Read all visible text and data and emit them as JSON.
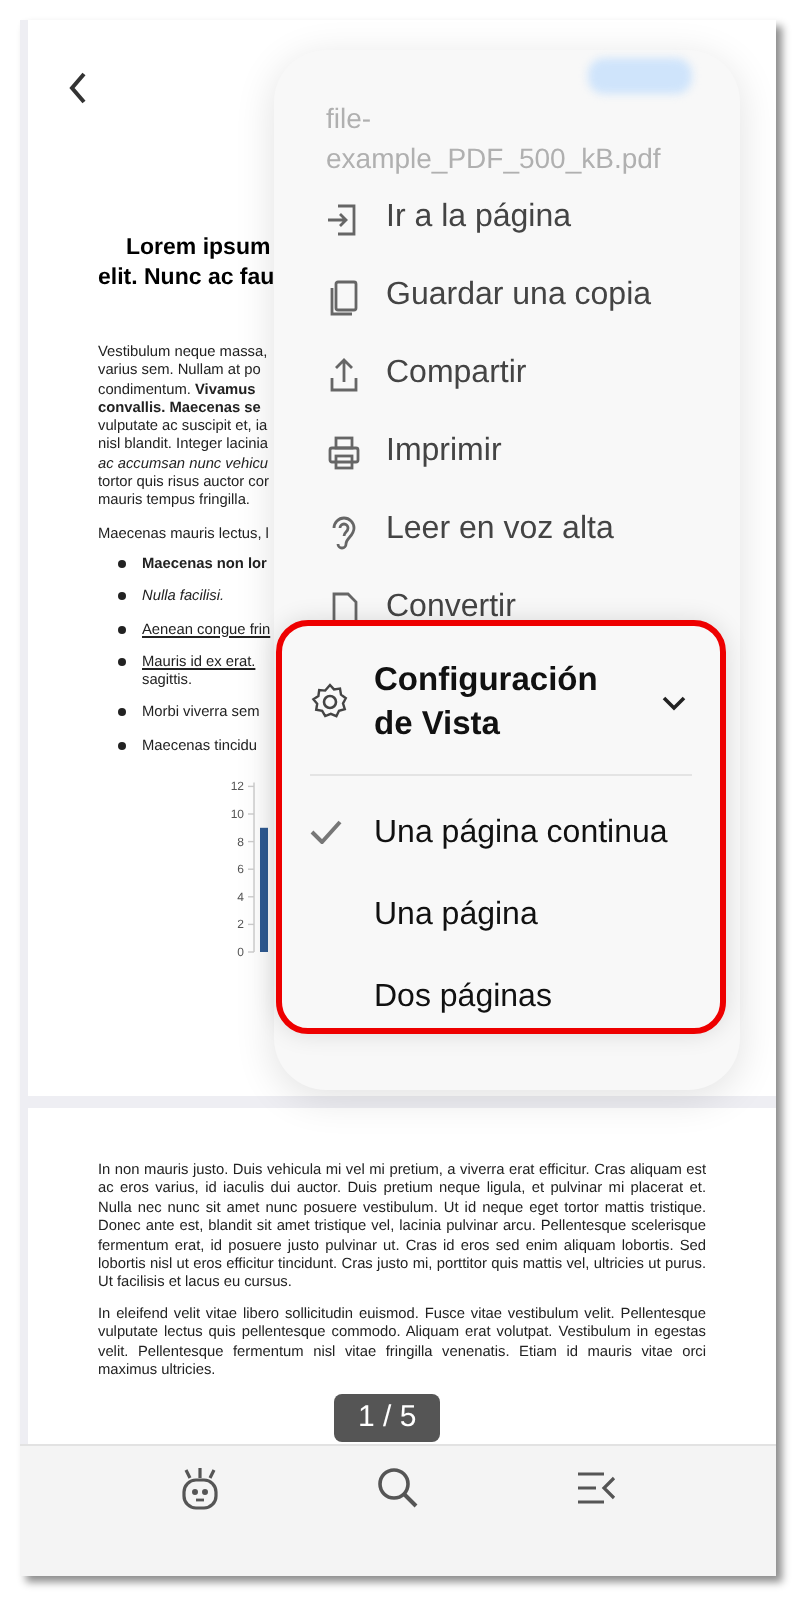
{
  "document": {
    "title_lines": [
      "Lorem ipsum",
      "elit. Nunc ac fau"
    ],
    "paragraph_lines": [
      "Vestibulum neque massa,",
      "varius sem. Nullam at po",
      "condimentum. **Vivamus**",
      "**convallis. Maecenas se**",
      "vulputate ac suscipit et, ia",
      "nisl blandit. Integer lacinia",
      "*ac accumsan nunc vehicu*",
      "tortor quis risus auctor cor",
      "mauris tempus fringilla."
    ],
    "paragraph2": "Maecenas mauris lectus, l",
    "bullets": [
      {
        "text": "Maecenas non lor",
        "kind": "bold"
      },
      {
        "text": "Nulla facilisi.",
        "kind": "italic"
      },
      {
        "text": "Aenean congue frin",
        "kind": "underline"
      },
      {
        "text": "Mauris id ex erat.",
        "kind": "underline",
        "continuation": "sagittis."
      },
      {
        "text": "Morbi viverra sem",
        "kind": "plain"
      },
      {
        "text": "Maecenas tincidu",
        "kind": "plain"
      }
    ],
    "chart_data": {
      "type": "bar",
      "yticks": [
        0,
        2,
        4,
        6,
        8,
        10,
        12
      ],
      "ylim": [
        0,
        12
      ],
      "series": [
        {
          "color": "#2f5b93",
          "values": [
            9
          ]
        }
      ]
    },
    "page2_paragraphs": [
      "In non mauris justo. Duis vehicula mi vel mi pretium, a viverra erat efficitur. Cras aliquam est ac eros varius, id iaculis dui auctor. Duis pretium neque ligula, et pulvinar mi placerat et. Nulla nec nunc sit amet nunc posuere vestibulum. Ut id neque eget tortor mattis tristique. Donec ante est, blandit sit amet tristique vel, lacinia pulvinar arcu. Pellentesque scelerisque fermentum erat, id posuere justo pulvinar ut. Cras id eros sed enim aliquam lobortis. Sed lobortis nisl ut eros efficitur tincidunt. Cras justo mi, porttitor quis mattis vel, ultricies ut purus. Ut facilisis et lacus eu cursus.",
      "In eleifend velit vitae libero sollicitudin euismod. Fusce vitae vestibulum velit. Pellentesque vulputate lectus quis pellentesque commodo. Aliquam erat volutpat. Vestibulum in egestas velit. Pellentesque fermentum nisl vitae fringilla venenatis. Etiam id mauris vitae orci maximus ultricies."
    ]
  },
  "page_indicator": "1 / 5",
  "menu": {
    "file_name": "file-example_PDF_500_kB.pdf",
    "items": [
      {
        "kind": "goto",
        "label": "Ir a la página"
      },
      {
        "kind": "copy",
        "label": "Guardar una copia"
      },
      {
        "kind": "share",
        "label": "Compartir"
      },
      {
        "kind": "print",
        "label": "Imprimir"
      },
      {
        "kind": "ear",
        "label": "Leer en voz alta"
      },
      {
        "kind": "file",
        "label": "Convertir"
      }
    ]
  },
  "view_settings": {
    "title": "Configuración de Vista",
    "expanded": true,
    "options": [
      {
        "label": "Una página continua",
        "selected": true
      },
      {
        "label": "Una página",
        "selected": false
      },
      {
        "label": "Dos páginas",
        "selected": false
      }
    ]
  },
  "toolbar": [
    {
      "kind": "robot"
    },
    {
      "kind": "search"
    },
    {
      "kind": "outline"
    }
  ]
}
